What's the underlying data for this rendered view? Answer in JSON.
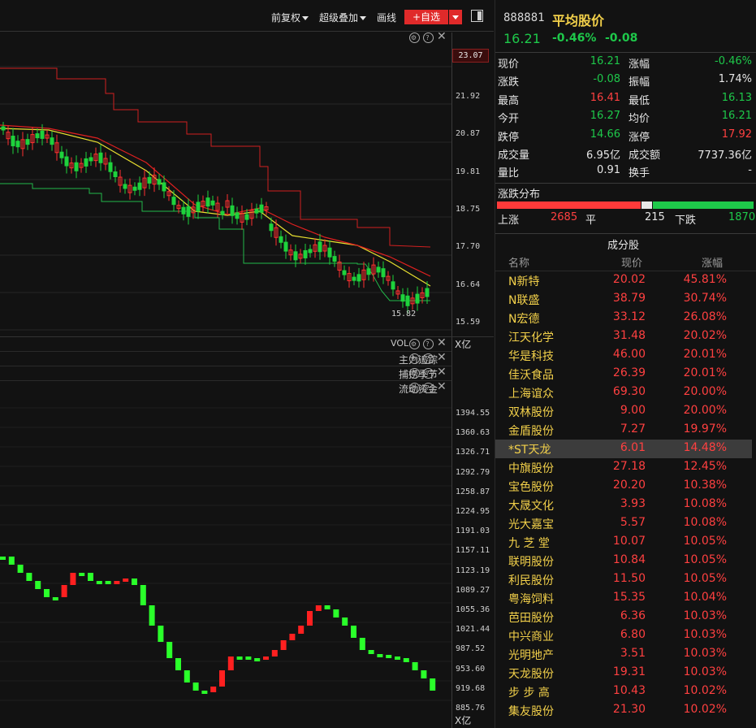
{
  "toolbar": {
    "adjust_label": "前复权",
    "overlay_label": "超级叠加",
    "draw_label": "画线",
    "add_watch_label": "+自选"
  },
  "chart_axis": {
    "price_current_tag": "23.07",
    "price_ticks": [
      "21.92",
      "20.87",
      "19.81",
      "18.75",
      "17.70",
      "16.64",
      "15.59"
    ],
    "low_annotation": "15.82",
    "vol_label": "VOL",
    "vol_unit": "X亿",
    "capital_ticks": [
      "1394.55",
      "1360.63",
      "1326.71",
      "1292.79",
      "1258.87",
      "1224.95",
      "1191.03",
      "1157.11",
      "1123.19",
      "1089.27",
      "1055.36",
      "1021.44",
      "987.52",
      "953.60",
      "919.68",
      "885.76"
    ],
    "bottom_unit": "X亿"
  },
  "indicators": [
    "主力追踪",
    "捕捞季节",
    "流动资金"
  ],
  "stock": {
    "code": "888881",
    "name": "平均股价",
    "price": "16.21",
    "change_pct": "-0.46%",
    "change": "-0.08"
  },
  "quote": {
    "rows": [
      {
        "l1": "现价",
        "v1": "16.21",
        "c1": "green",
        "l2": "涨幅",
        "v2": "-0.46%",
        "c2": "green"
      },
      {
        "l1": "涨跌",
        "v1": "-0.08",
        "c1": "green",
        "l2": "振幅",
        "v2": "1.74%",
        "c2": "white"
      },
      {
        "l1": "最高",
        "v1": "16.41",
        "c1": "red",
        "l2": "最低",
        "v2": "16.13",
        "c2": "green"
      },
      {
        "l1": "今开",
        "v1": "16.27",
        "c1": "green",
        "l2": "均价",
        "v2": "16.21",
        "c2": "green"
      },
      {
        "l1": "跌停",
        "v1": "14.66",
        "c1": "green",
        "l2": "涨停",
        "v2": "17.92",
        "c2": "red"
      },
      {
        "l1": "成交量",
        "v1": "6.95亿",
        "c1": "white",
        "l2": "成交额",
        "v2": "7737.36亿",
        "c2": "white"
      },
      {
        "l1": "量比",
        "v1": "0.91",
        "c1": "white",
        "l2": "换手",
        "v2": "-",
        "c2": "white"
      }
    ]
  },
  "distribution": {
    "title": "涨跌分布",
    "up_label": "上涨",
    "up_count": "2685",
    "flat_label": "平",
    "flat_count": "215",
    "down_label": "下跌",
    "down_count": "1870",
    "up_fraction": 0.5629,
    "flat_fraction": 0.0451,
    "down_fraction": 0.392
  },
  "components": {
    "title": "成分股",
    "headers": {
      "name": "名称",
      "price": "现价",
      "pct": "涨幅"
    },
    "rows": [
      {
        "name": "N新特",
        "price": "20.02",
        "pct": "45.81%"
      },
      {
        "name": "N联盛",
        "price": "38.79",
        "pct": "30.74%"
      },
      {
        "name": "N宏德",
        "price": "33.12",
        "pct": "26.08%"
      },
      {
        "name": "江天化学",
        "price": "31.48",
        "pct": "20.02%"
      },
      {
        "name": "华是科技",
        "price": "46.00",
        "pct": "20.01%"
      },
      {
        "name": "佳沃食品",
        "price": "26.39",
        "pct": "20.01%"
      },
      {
        "name": "上海谊众",
        "price": "69.30",
        "pct": "20.00%"
      },
      {
        "name": "双林股份",
        "price": "9.00",
        "pct": "20.00%"
      },
      {
        "name": "金盾股份",
        "price": "7.27",
        "pct": "19.97%"
      },
      {
        "name": "*ST天龙",
        "price": "6.01",
        "pct": "14.48%",
        "selected": true
      },
      {
        "name": "中旗股份",
        "price": "27.18",
        "pct": "12.45%"
      },
      {
        "name": "宝色股份",
        "price": "20.20",
        "pct": "10.38%"
      },
      {
        "name": "大晟文化",
        "price": "3.93",
        "pct": "10.08%"
      },
      {
        "name": "光大嘉宝",
        "price": "5.57",
        "pct": "10.08%"
      },
      {
        "name": "九 芝 堂",
        "price": "10.07",
        "pct": "10.05%"
      },
      {
        "name": "联明股份",
        "price": "10.84",
        "pct": "10.05%"
      },
      {
        "name": "利民股份",
        "price": "11.50",
        "pct": "10.05%"
      },
      {
        "name": "粤海饲料",
        "price": "15.35",
        "pct": "10.04%"
      },
      {
        "name": "芭田股份",
        "price": "6.36",
        "pct": "10.03%"
      },
      {
        "name": "中兴商业",
        "price": "6.80",
        "pct": "10.03%"
      },
      {
        "name": "光明地产",
        "price": "3.51",
        "pct": "10.03%",
        "name_color": "cyan"
      },
      {
        "name": "天龙股份",
        "price": "19.31",
        "pct": "10.03%"
      },
      {
        "name": "步 步 高",
        "price": "10.43",
        "pct": "10.02%"
      },
      {
        "name": "集友股份",
        "price": "21.30",
        "pct": "10.02%"
      }
    ]
  },
  "colors": {
    "up": "#ff4040",
    "down": "#1ec84a",
    "name": "#f2d04a",
    "bg": "#121212"
  }
}
